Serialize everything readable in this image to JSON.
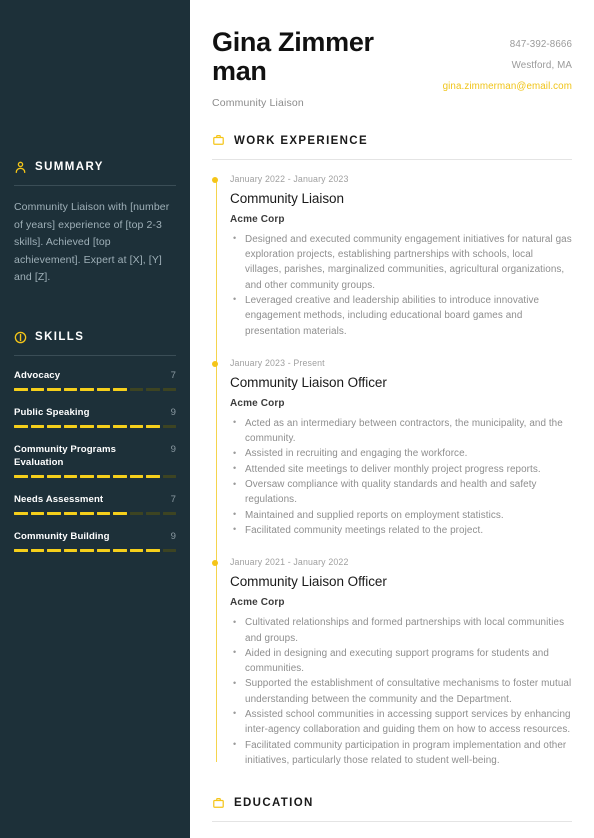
{
  "theme": {
    "sidebar_bg": "#1d3039",
    "accent": "#f5c518",
    "accent_text": "#f0c419",
    "skill_on": "#f5cf1b",
    "skill_off": "#3d4422",
    "body_text": "#8e8e8e",
    "heading_text": "#1a1a1a"
  },
  "sidebar": {
    "summary": {
      "icon": "user-icon",
      "title": "SUMMARY",
      "text": "Community Liaison with [number of years] experience of [top 2-3 skills]. Achieved [top achievement]. Expert at [X], [Y] and [Z]."
    },
    "skills": {
      "icon": "skill-meter-icon",
      "title": "SKILLS",
      "max": 10,
      "items": [
        {
          "name": "Advocacy",
          "score": 7
        },
        {
          "name": "Public Speaking",
          "score": 9
        },
        {
          "name": "Community Programs Evaluation",
          "score": 9
        },
        {
          "name": "Needs Assessment",
          "score": 7
        },
        {
          "name": "Community Building",
          "score": 9
        }
      ]
    }
  },
  "header": {
    "name": "Gina Zimmerman",
    "job_title": "Community Liaison",
    "phone": "847-392-8666",
    "location": "Westford, MA",
    "email": "gina.zimmerman@email.com"
  },
  "work_experience": {
    "icon": "briefcase-icon",
    "title": "WORK EXPERIENCE",
    "entries": [
      {
        "date": "January 2022 - January 2023",
        "role": "Community Liaison",
        "company": "Acme Corp",
        "bullets": [
          "Designed and executed community engagement initiatives for natural gas exploration projects, establishing partnerships with schools, local villages, parishes, marginalized communities, agricultural organizations, and other community groups.",
          "Leveraged creative and leadership abilities to introduce innovative engagement methods, including educational board games and presentation materials."
        ]
      },
      {
        "date": "January 2023 - Present",
        "role": "Community Liaison Officer",
        "company": "Acme Corp",
        "bullets": [
          "Acted as an intermediary between contractors, the municipality, and the community.",
          "Assisted in recruiting and engaging the workforce.",
          "Attended site meetings to deliver monthly project progress reports.",
          "Oversaw compliance with quality standards and health and safety regulations.",
          "Maintained and supplied reports on employment statistics.",
          "Facilitated community meetings related to the project."
        ]
      },
      {
        "date": "January 2021 - January 2022",
        "role": "Community Liaison Officer",
        "company": "Acme Corp",
        "bullets": [
          "Cultivated relationships and formed partnerships with local communities and groups.",
          "Aided in designing and executing support programs for students and communities.",
          "Supported the establishment of consultative mechanisms to foster mutual understanding between the community and the Department.",
          "Assisted school communities in accessing support services by enhancing inter-agency collaboration and guiding them on how to access resources.",
          "Facilitated community participation in program implementation and other initiatives, particularly those related to student well-being."
        ]
      }
    ]
  },
  "education": {
    "icon": "briefcase-icon",
    "title": "EDUCATION"
  }
}
